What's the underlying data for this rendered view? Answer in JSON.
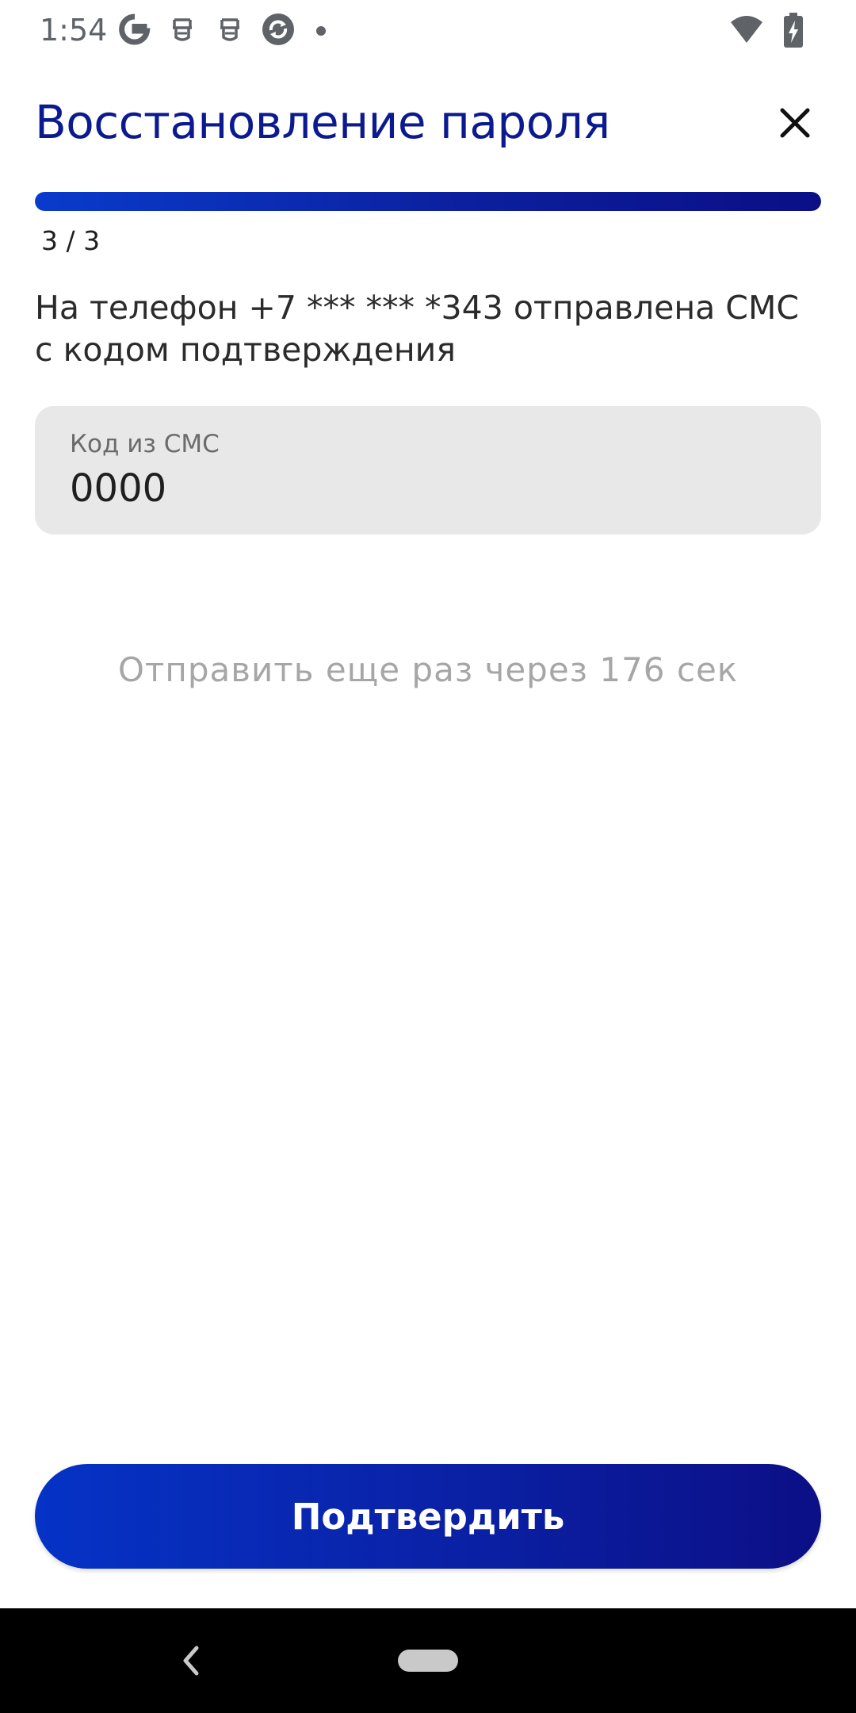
{
  "status_bar": {
    "time": "1:54",
    "left_icons": [
      "google-icon",
      "notification-app-icon",
      "notification-app-icon",
      "sync-app-icon",
      "more-notifications-dot-icon"
    ],
    "right_icons": [
      "wifi-icon",
      "battery-charging-icon"
    ]
  },
  "header": {
    "title": "Восстановление пароля",
    "close_icon": "close-icon"
  },
  "progress": {
    "step_text": "3 / 3",
    "current_step": 3,
    "total_steps": 3
  },
  "info": {
    "text": "На телефон +7 *** *** *343 отправлена СМС с кодом подтверждения"
  },
  "code_field": {
    "label": "Код из СМС",
    "value": "0000"
  },
  "resend": {
    "text": "Отправить еще раз через 176 сек"
  },
  "confirm_button": {
    "label": "Подтвердить"
  },
  "nav_bar": {
    "back_icon": "back-chevron-icon",
    "home_icon": "home-pill-icon"
  },
  "colors": {
    "title": "#0b1a8f",
    "accent_start": "#0533c6",
    "accent_end": "#0c0f86",
    "field_background": "#e8e8e8",
    "muted_text": "#a6a6a6",
    "nav_background": "#000000"
  }
}
